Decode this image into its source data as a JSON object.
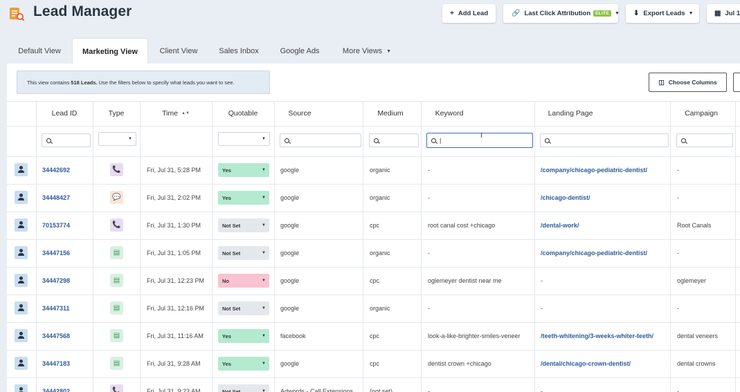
{
  "app": {
    "title": "Lead Manager"
  },
  "header": {
    "add_lead": "Add Lead",
    "attribution": "Last Click Attribution",
    "attribution_badge": "ELITE",
    "export": "Export Leads",
    "date": "Jul 1,"
  },
  "tabs": [
    "Default View",
    "Marketing View",
    "Client View",
    "Sales Inbox",
    "Google Ads",
    "More Views"
  ],
  "active_tab": "Marketing View",
  "info": {
    "prefix": "This view contains",
    "count": "518 Leads.",
    "suffix": "Use the filters below to specify what leads you want to see."
  },
  "choose_columns": "Choose Columns",
  "columns": [
    "Lead ID",
    "Type",
    "Time",
    "Quotable",
    "Source",
    "Medium",
    "Keyword",
    "Landing Page",
    "Campaign"
  ],
  "keyword_filter_value": "|",
  "rows": [
    {
      "id": "34442692",
      "type": "call",
      "time": "Fri, Jul 31, 5:28 PM",
      "quotable": "Yes",
      "source": "google",
      "medium": "organic",
      "keyword": "-",
      "landing": "/company/chicago-pediatric-dentist/",
      "campaign": "-"
    },
    {
      "id": "34448427",
      "type": "chat",
      "time": "Fri, Jul 31, 2:02 PM",
      "quotable": "Yes",
      "source": "google",
      "medium": "organic",
      "keyword": "-",
      "landing": "/chicago-dentist/",
      "campaign": "-"
    },
    {
      "id": "70153774",
      "type": "call",
      "time": "Fri, Jul 31, 1:30 PM",
      "quotable": "Not Set",
      "source": "google",
      "medium": "cpc",
      "keyword": "root canal cost +chicago",
      "landing": "/dental-work/",
      "campaign": "Root Canals"
    },
    {
      "id": "34447156",
      "type": "form",
      "time": "Fri, Jul 31, 1:05 PM",
      "quotable": "Not Set",
      "source": "google",
      "medium": "organic",
      "keyword": "-",
      "landing": "/company/chicago-pediatric-dentist/",
      "campaign": "-"
    },
    {
      "id": "34447298",
      "type": "form",
      "time": "Fri, Jul 31, 12:23 PM",
      "quotable": "No",
      "source": "google",
      "medium": "cpc",
      "keyword": "oglemeyer dentist near me",
      "landing": "-",
      "campaign": "oglemeyer"
    },
    {
      "id": "34447311",
      "type": "form",
      "time": "Fri, Jul 31, 12:16 PM",
      "quotable": "Not Set",
      "source": "google",
      "medium": "organic",
      "keyword": "-",
      "landing": "-",
      "campaign": "-"
    },
    {
      "id": "34447568",
      "type": "form",
      "time": "Fri, Jul 31, 11:16 AM",
      "quotable": "Yes",
      "source": "facebook",
      "medium": "cpc",
      "keyword": "look-a-like-brighter-smiles-veneer",
      "landing": "/teeth-whitening/3-weeks-whiter-teeth/",
      "campaign": "dental veneers"
    },
    {
      "id": "34447183",
      "type": "form",
      "time": "Fri, Jul 31, 9:28 AM",
      "quotable": "Yes",
      "source": "google",
      "medium": "cpc",
      "keyword": "dentist crown +chicago",
      "landing": "/dental/chicago-crown-dentist/",
      "campaign": "dental crowns"
    },
    {
      "id": "34442802",
      "type": "call",
      "time": "Fri, Jul 31, 9:23 AM",
      "quotable": "Not Set",
      "source": "Adwords - Call Extensions",
      "medium": "(not set)",
      "keyword": "-",
      "landing": "-",
      "campaign": "-"
    }
  ],
  "colors": {
    "accent": "#2c5c9c",
    "yes": "#b3ead0",
    "no": "#f9c3d1",
    "not_set": "#e4e8ed",
    "elite": "#8bc34a",
    "logo": "#f39a3a"
  }
}
